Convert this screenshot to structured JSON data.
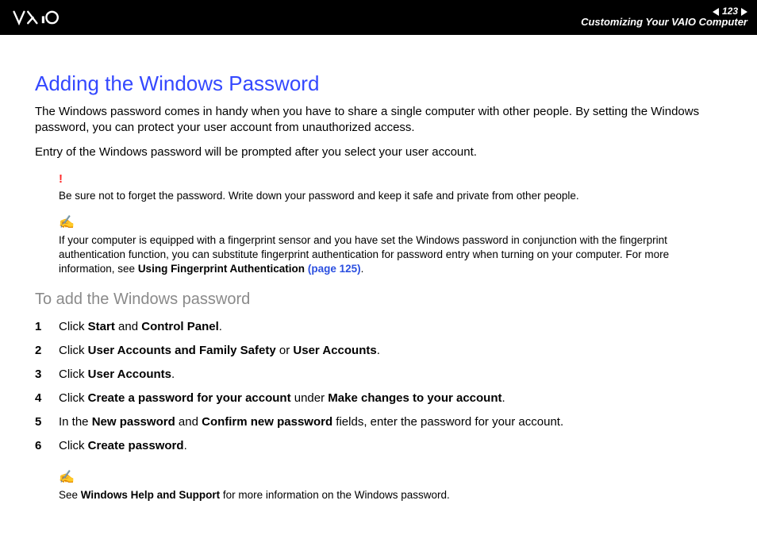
{
  "header": {
    "page_number": "123",
    "section": "Customizing Your VAIO Computer"
  },
  "main": {
    "title": "Adding the Windows Password",
    "para1": "The Windows password comes in handy when you have to share a single computer with other people. By setting the Windows password, you can protect your user account from unauthorized access.",
    "para2": "Entry of the Windows password will be prompted after you select your user account.",
    "warning": "Be sure not to forget the password. Write down your password and keep it safe and private from other people.",
    "tip1_a": "If your computer is equipped with a fingerprint sensor and you have set the Windows password in conjunction with the fingerprint authentication function, you can substitute fingerprint authentication for password entry when turning on your computer. For more information, see ",
    "tip1_b": "Using Fingerprint Authentication",
    "tip1_link": "(page 125)",
    "tip1_c": ".",
    "subtitle": "To add the Windows password",
    "steps": {
      "s1_a": "Click ",
      "s1_b": "Start",
      "s1_c": " and ",
      "s1_d": "Control Panel",
      "s1_e": ".",
      "s2_a": "Click ",
      "s2_b": "User Accounts and Family Safety",
      "s2_c": " or ",
      "s2_d": "User Accounts",
      "s2_e": ".",
      "s3_a": "Click ",
      "s3_b": "User Accounts",
      "s3_c": ".",
      "s4_a": "Click ",
      "s4_b": "Create a password for your account",
      "s4_c": " under ",
      "s4_d": "Make changes to your account",
      "s4_e": ".",
      "s5_a": "In the ",
      "s5_b": "New password",
      "s5_c": " and ",
      "s5_d": "Confirm new password",
      "s5_e": " fields, enter the password for your account.",
      "s6_a": "Click ",
      "s6_b": "Create password",
      "s6_c": "."
    },
    "tip2_a": "See ",
    "tip2_b": "Windows Help and Support",
    "tip2_c": " for more information on the Windows password."
  }
}
